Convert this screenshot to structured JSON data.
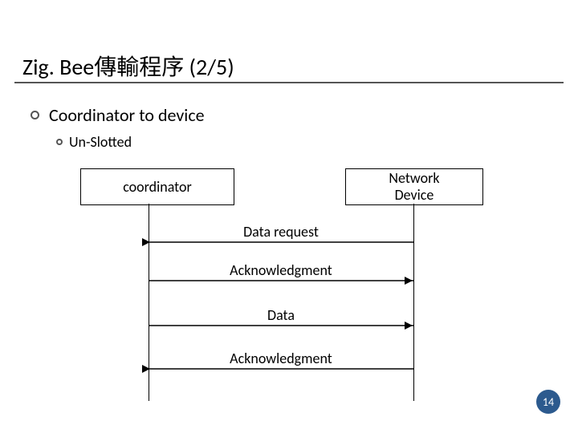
{
  "title": "Zig. Bee傳輸程序 (2/5)",
  "bullets": {
    "lvl1": {
      "text": "Coordinator",
      "suffix": " to device"
    },
    "lvl2": "Un-Slotted"
  },
  "diagram": {
    "left_box": "coordinator",
    "right_box": "Network\nDevice",
    "messages": [
      {
        "label": "Data request",
        "dir": "left"
      },
      {
        "label": "Acknowledgment",
        "dir": "right"
      },
      {
        "label": "Data",
        "dir": "right"
      },
      {
        "label": "Acknowledgment",
        "dir": "left"
      }
    ]
  },
  "page_number": "14"
}
